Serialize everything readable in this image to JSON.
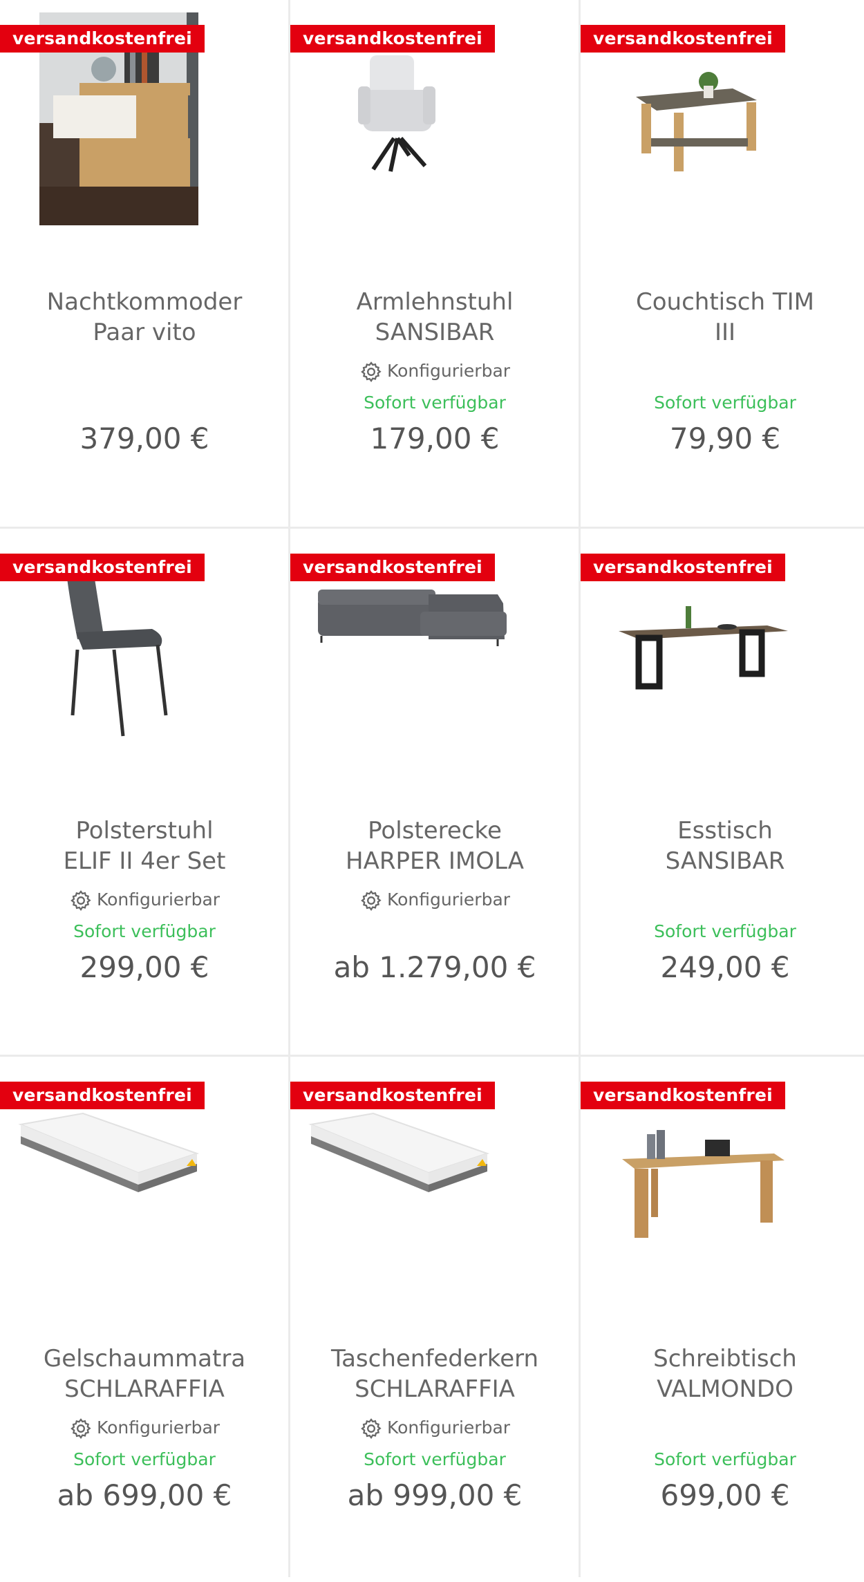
{
  "badge_label": "versandkostenfrei",
  "config_label": "Konfigurierbar",
  "availability_label": "Sofort verfügbar",
  "colors": {
    "badge": "#e3000f",
    "available": "#3cbf5a"
  },
  "products": [
    {
      "title_line1": "Nachtkommoder",
      "title_line2": "Paar vito",
      "configurable": false,
      "available": false,
      "price": "379,00 €",
      "image": "nightstand"
    },
    {
      "title_line1": "Armlehnstuhl",
      "title_line2": "SANSIBAR",
      "configurable": true,
      "available": true,
      "price": "179,00 €",
      "image": "armchair"
    },
    {
      "title_line1": "Couchtisch TIM",
      "title_line2": "III",
      "configurable": false,
      "available": true,
      "price": "79,90 €",
      "image": "coffee-table"
    },
    {
      "title_line1": "Polsterstuhl",
      "title_line2": "ELIF II 4er Set",
      "configurable": true,
      "available": true,
      "price": "299,00 €",
      "image": "dining-chair"
    },
    {
      "title_line1": "Polsterecke",
      "title_line2": "HARPER IMOLA",
      "configurable": true,
      "available": false,
      "price": "ab 1.279,00 €",
      "image": "corner-sofa"
    },
    {
      "title_line1": "Esstisch",
      "title_line2": "SANSIBAR",
      "configurable": false,
      "available": true,
      "price": "249,00 €",
      "image": "dining-table"
    },
    {
      "title_line1": "Gelschaummatra",
      "title_line2": "SCHLARAFFIA",
      "configurable": true,
      "available": true,
      "price": "ab 699,00 €",
      "image": "mattress"
    },
    {
      "title_line1": "Taschenfederkern",
      "title_line2": "SCHLARAFFIA",
      "configurable": true,
      "available": true,
      "price": "ab 999,00 €",
      "image": "mattress"
    },
    {
      "title_line1": "Schreibtisch",
      "title_line2": "VALMONDO",
      "configurable": false,
      "available": true,
      "price": "699,00 €",
      "image": "desk"
    }
  ]
}
